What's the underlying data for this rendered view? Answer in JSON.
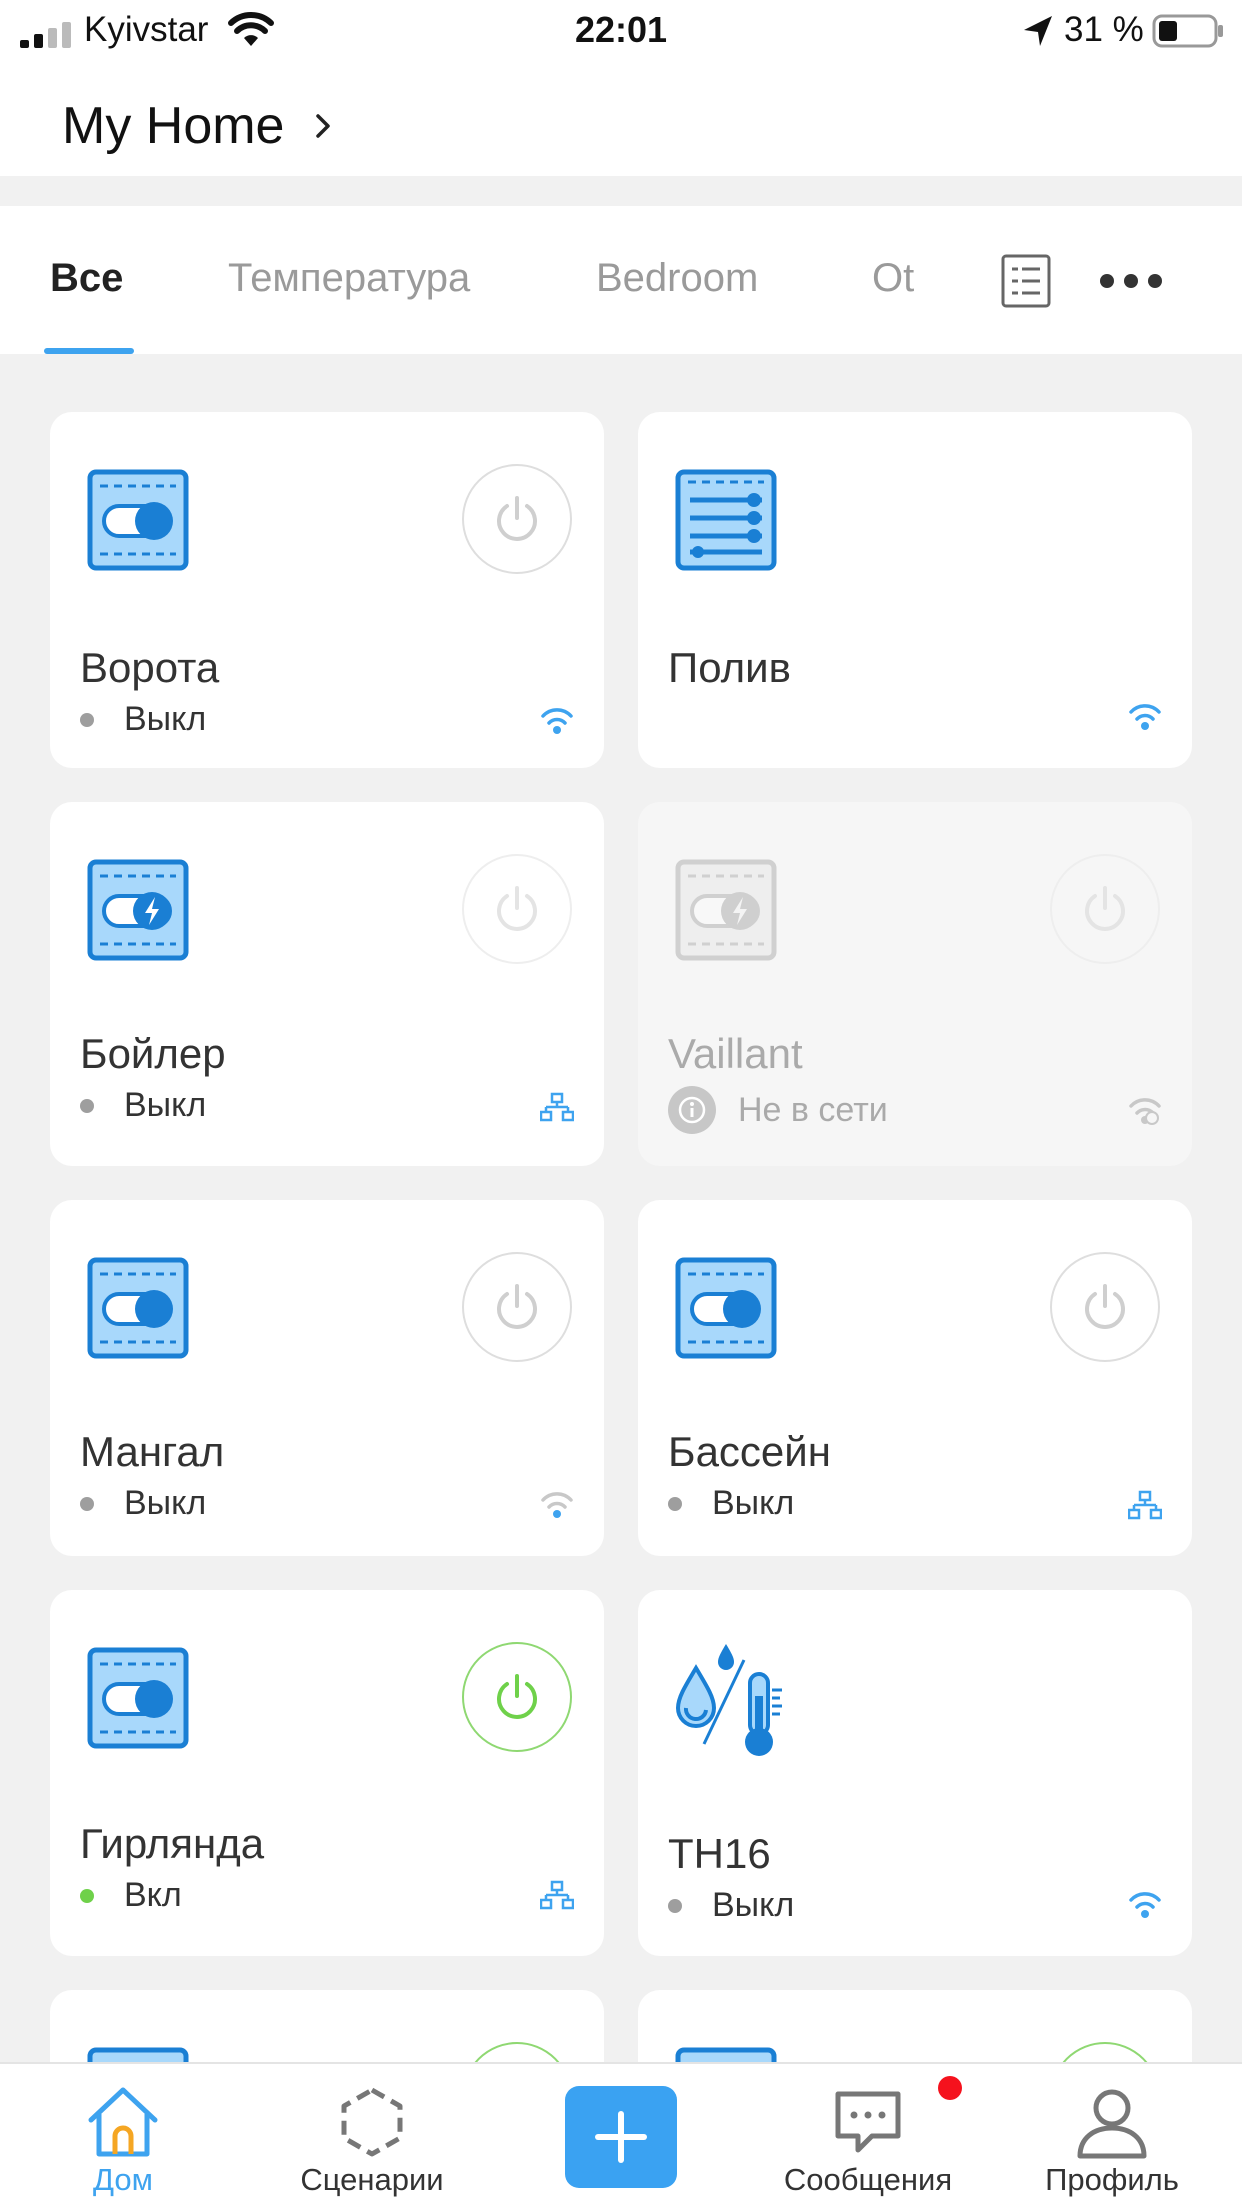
{
  "status_bar": {
    "carrier": "Kyivstar",
    "time": "22:01",
    "battery": "31 %"
  },
  "header": {
    "title": "My Home"
  },
  "tabs": [
    {
      "label": "Все",
      "active": true
    },
    {
      "label": "Температура",
      "active": false
    },
    {
      "label": "Bedroom",
      "active": false
    },
    {
      "label": "Ot",
      "active": false
    }
  ],
  "devices": [
    {
      "name": "Ворота",
      "status": "Выкл",
      "icon": "switch-icon",
      "power": "off",
      "connection": "wifi-icon"
    },
    {
      "name": "Полив",
      "status": "",
      "icon": "sliders-icon",
      "power": "none",
      "connection": "wifi-icon"
    },
    {
      "name": "Бойлер",
      "status": "Выкл",
      "icon": "boiler-switch-icon",
      "power": "off-faded",
      "connection": "network-icon"
    },
    {
      "name": "Vaillant",
      "status": "Не в сети",
      "icon": "boiler-switch-icon",
      "power": "off-faded",
      "connection": "wifi-off-icon",
      "offline": true
    },
    {
      "name": "Мангал",
      "status": "Выкл",
      "icon": "switch-icon",
      "power": "off",
      "connection": "wifi-icon"
    },
    {
      "name": "Бассейн",
      "status": "Выкл",
      "icon": "switch-icon",
      "power": "off",
      "connection": "network-icon"
    },
    {
      "name": "Гирлянда",
      "status": "Вкл",
      "icon": "switch-icon",
      "power": "on",
      "connection": "network-icon"
    },
    {
      "name": "TH16",
      "status": "Выкл",
      "icon": "humidity-temperature-icon",
      "power": "none",
      "connection": "wifi-icon"
    }
  ],
  "bottom_nav": [
    {
      "label": "Дом",
      "icon": "home-icon",
      "active": true
    },
    {
      "label": "Сценарии",
      "icon": "scenes-icon",
      "active": false
    },
    {
      "label": "",
      "icon": "plus-icon",
      "active": false
    },
    {
      "label": "Сообщения",
      "icon": "messages-icon",
      "active": false,
      "badge": true
    },
    {
      "label": "Профиль",
      "icon": "profile-icon",
      "active": false
    }
  ],
  "colors": {
    "accent": "#3ea3ef",
    "icon_blue": "#1a7fd4",
    "icon_fill": "#a8d8fb",
    "power_on": "#6fd14a",
    "badge": "#f5121d",
    "page_background": "#f1f1f1"
  }
}
